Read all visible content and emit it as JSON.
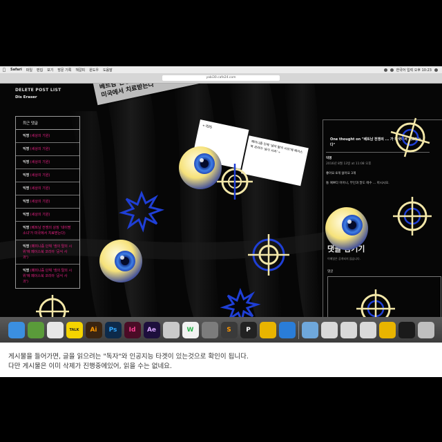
{
  "menubar": {
    "app": "Safari",
    "items": [
      "파일",
      "편집",
      "보기",
      "방문 기록",
      "책갈피",
      "윈도우",
      "도움말"
    ],
    "status": "한국어 입력 오후 10:23"
  },
  "browser": {
    "url": "yabi30.cafe24.com"
  },
  "site": {
    "title": "DELETE POST LIST",
    "subtitle": "Dis Eraser"
  },
  "sidebar": {
    "header": "최근 댓글",
    "rows": [
      {
        "name": "익명",
        "text": "(세상의 기원)"
      },
      {
        "name": "익명",
        "text": "(세상의 기원)"
      },
      {
        "name": "익명",
        "text": "(세상의 기원)"
      },
      {
        "name": "익명",
        "text": "(세상의 기원)"
      },
      {
        "name": "익명",
        "text": "(세상의 기원)"
      },
      {
        "name": "익명",
        "text": "(세상의 기원)"
      },
      {
        "name": "익명",
        "text": "(세상의 기원)"
      },
      {
        "name": "익명",
        "text": "(베트남 전쟁의 상징 '네이팜 소녀'가 미국에서 치료받는다)"
      },
      {
        "name": "익명",
        "text": "(페미니즘 단체 '생의 탈의 시위'에 페이스북 코리아 '공식 사과')"
      },
      {
        "name": "익명",
        "text": "(페미니즘 단체 '생의 탈의 시위'에 페이스북 코리아 '공식 사과')"
      }
    ]
  },
  "headline": "베트남 전쟁의 상징 '네이팜 소녀'가 미국에서 치료받는다",
  "snippets": {
    "left": "« ISIS",
    "right": "페미니즘 단체 '생의 탈의 시위'에 페이스북 코리아 '공식 사과' »"
  },
  "right_panel": {
    "title": "One thought on \"베트남 전쟁의 ... 가 미국에서 치료받는다\"",
    "comment_name": "익명",
    "comment_date": "2016년 8월 13일 at 11:08 오후",
    "reactions": "좋아요 8개   싫어요 3개",
    "body": "통 예쁘다 어어니, 부인과 말도 에수 ... 아시시오.",
    "reply_title": "댓글 남기기",
    "reply_note": "이메일은 공개되지 않습니다.",
    "comment_label": "댓글"
  },
  "dock": {
    "items": [
      {
        "icon": "finder-icon",
        "label": "",
        "color": "#3b8fe0"
      },
      {
        "icon": "evernote-icon",
        "label": "",
        "color": "#5a9b3a"
      },
      {
        "icon": "chrome-icon",
        "label": "",
        "color": "#e7e7e7"
      },
      {
        "icon": "kakaotalk-icon",
        "label": "TALK",
        "color": "#f5d400"
      },
      {
        "icon": "illustrator-icon",
        "label": "Ai",
        "color": "#3a2410"
      },
      {
        "icon": "photoshop-icon",
        "label": "Ps",
        "color": "#0d2a4a"
      },
      {
        "icon": "indesign-icon",
        "label": "Id",
        "color": "#4a0c26"
      },
      {
        "icon": "after-effects-icon",
        "label": "Ae",
        "color": "#1d0f3c"
      },
      {
        "icon": "preview-icon",
        "label": "",
        "color": "#c9c9c9"
      },
      {
        "icon": "wechat-icon",
        "label": "W",
        "color": "#f2f2f2"
      },
      {
        "icon": "system-preferences-icon",
        "label": "",
        "color": "#7c7c7c"
      },
      {
        "icon": "sublime-icon",
        "label": "S",
        "color": "#3a3a3a"
      },
      {
        "icon": "p-app-icon",
        "label": "P",
        "color": "#222222"
      },
      {
        "icon": "duck-icon",
        "label": "",
        "color": "#e9b400"
      },
      {
        "icon": "safari-icon",
        "label": "",
        "color": "#2a7dd8"
      },
      {
        "icon": "folder-icon",
        "label": "",
        "color": "#6fa8dc"
      },
      {
        "icon": "doc-icon",
        "label": "",
        "color": "#d9d9d9"
      },
      {
        "icon": "doc-icon",
        "label": "",
        "color": "#d9d9d9"
      },
      {
        "icon": "doc-icon",
        "label": "",
        "color": "#d9d9d9"
      },
      {
        "icon": "duck-icon",
        "label": "",
        "color": "#e9b400"
      },
      {
        "icon": "terminal-icon",
        "label": "",
        "color": "#1a1a1a"
      },
      {
        "icon": "trash-icon",
        "label": "",
        "color": "#bfbfbf"
      }
    ]
  },
  "caption": {
    "line1": "게시물을 들어가면, 글을 읽으려는 \"독자\"와 인공지능 타겟이 있는것으로 확인이 됩니다.",
    "line2": "다만 게시물은 이미 삭제가 진행중에있어, 읽을 수는 없네요."
  },
  "colors": {
    "eye_yellow": "#f6e27a",
    "eye_blue": "#2a56c8",
    "target": "#f3e7a8",
    "splat": "#1f3fd6"
  }
}
